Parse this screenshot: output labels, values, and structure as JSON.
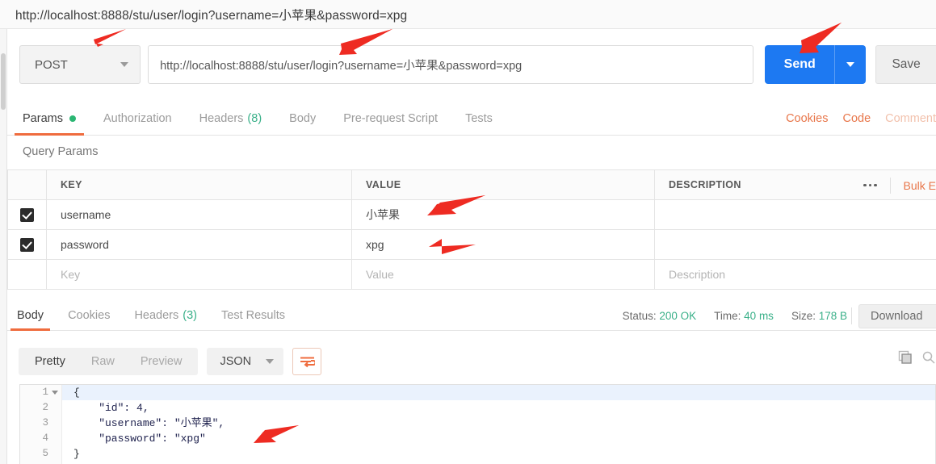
{
  "window": {
    "title_url": "http://localhost:8888/stu/user/login?username=小苹果&password=xpg"
  },
  "request": {
    "method": "POST",
    "url": "http://localhost:8888/stu/user/login?username=小苹果&password=xpg",
    "send_label": "Send",
    "save_label": "Save",
    "tabs": [
      {
        "label": "Params",
        "badge": "",
        "active": true,
        "dot": true
      },
      {
        "label": "Authorization",
        "badge": "",
        "active": false,
        "dot": false
      },
      {
        "label": "Headers",
        "badge": "(8)",
        "active": false,
        "dot": false
      },
      {
        "label": "Body",
        "badge": "",
        "active": false,
        "dot": false
      },
      {
        "label": "Pre-request Script",
        "badge": "",
        "active": false,
        "dot": false
      },
      {
        "label": "Tests",
        "badge": "",
        "active": false,
        "dot": false
      }
    ],
    "links": {
      "cookies": "Cookies",
      "code": "Code",
      "comment": "Comment"
    }
  },
  "query_params": {
    "section_title": "Query Params",
    "columns": [
      "KEY",
      "VALUE",
      "DESCRIPTION"
    ],
    "bulk_edit_label": "Bulk E",
    "rows": [
      {
        "checked": true,
        "key": "username",
        "value": "小苹果",
        "description": ""
      },
      {
        "checked": true,
        "key": "password",
        "value": "xpg",
        "description": ""
      }
    ],
    "placeholder_row": {
      "key": "Key",
      "value": "Value",
      "description": "Description"
    }
  },
  "response": {
    "tabs": [
      {
        "label": "Body",
        "badge": "",
        "active": true
      },
      {
        "label": "Cookies",
        "badge": "",
        "active": false
      },
      {
        "label": "Headers",
        "badge": "(3)",
        "active": false
      },
      {
        "label": "Test Results",
        "badge": "",
        "active": false
      }
    ],
    "status_label": "Status:",
    "status_value": "200 OK",
    "time_label": "Time:",
    "time_value": "40 ms",
    "size_label": "Size:",
    "size_value": "178 B",
    "download_label": "Download",
    "viewer": {
      "modes": [
        {
          "label": "Pretty",
          "active": true
        },
        {
          "label": "Raw",
          "active": false
        },
        {
          "label": "Preview",
          "active": false
        }
      ],
      "format": "JSON"
    },
    "body_lines": [
      {
        "n": "1",
        "fold": true,
        "html": "{"
      },
      {
        "n": "2",
        "fold": false,
        "html": "    \"id\": 4,"
      },
      {
        "n": "3",
        "fold": false,
        "html": "    \"username\": \"小苹果\","
      },
      {
        "n": "4",
        "fold": false,
        "html": "    \"password\": \"xpg\""
      },
      {
        "n": "5",
        "fold": false,
        "html": "}"
      }
    ]
  },
  "colors": {
    "accent_orange": "#ef6c3e",
    "send_blue": "#1d79f2",
    "status_green": "#3ab089",
    "annotation_red": "#ee2b22"
  }
}
